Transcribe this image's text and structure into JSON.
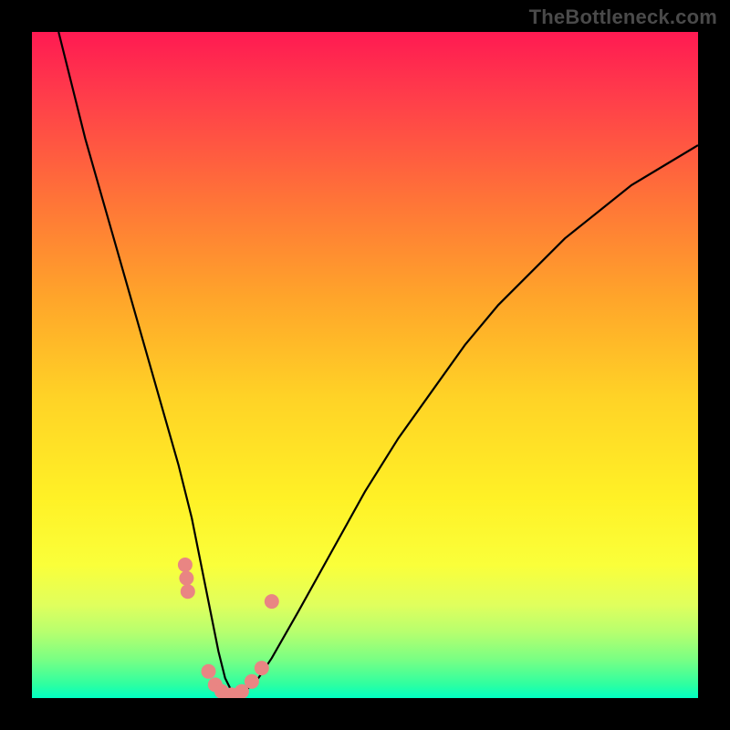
{
  "watermark": "TheBottleneck.com",
  "chart_data": {
    "type": "line",
    "title": "",
    "xlabel": "",
    "ylabel": "",
    "xlim": [
      0,
      100
    ],
    "ylim": [
      0,
      100
    ],
    "series": [
      {
        "name": "bottleneck-curve",
        "x": [
          4,
          6,
          8,
          10,
          12,
          14,
          16,
          18,
          20,
          22,
          24,
          26,
          27,
          28,
          29,
          30,
          31,
          32,
          34,
          36,
          40,
          45,
          50,
          55,
          60,
          65,
          70,
          75,
          80,
          85,
          90,
          95,
          100
        ],
        "values": [
          100,
          92,
          84,
          77,
          70,
          63,
          56,
          49,
          42,
          35,
          27,
          17,
          12,
          7,
          3,
          1,
          0.5,
          1,
          3,
          6,
          13,
          22,
          31,
          39,
          46,
          53,
          59,
          64,
          69,
          73,
          77,
          80,
          83
        ]
      }
    ],
    "markers": [
      {
        "x": 23.0,
        "y": 20.0
      },
      {
        "x": 23.2,
        "y": 18.0
      },
      {
        "x": 23.4,
        "y": 16.0
      },
      {
        "x": 26.5,
        "y": 4.0
      },
      {
        "x": 27.5,
        "y": 2.0
      },
      {
        "x": 28.5,
        "y": 1.0
      },
      {
        "x": 30.0,
        "y": 0.5
      },
      {
        "x": 31.5,
        "y": 1.0
      },
      {
        "x": 33.0,
        "y": 2.5
      },
      {
        "x": 34.5,
        "y": 4.5
      },
      {
        "x": 36.0,
        "y": 14.5
      }
    ],
    "marker_color": "#e98583",
    "curve_color": "#000000"
  }
}
